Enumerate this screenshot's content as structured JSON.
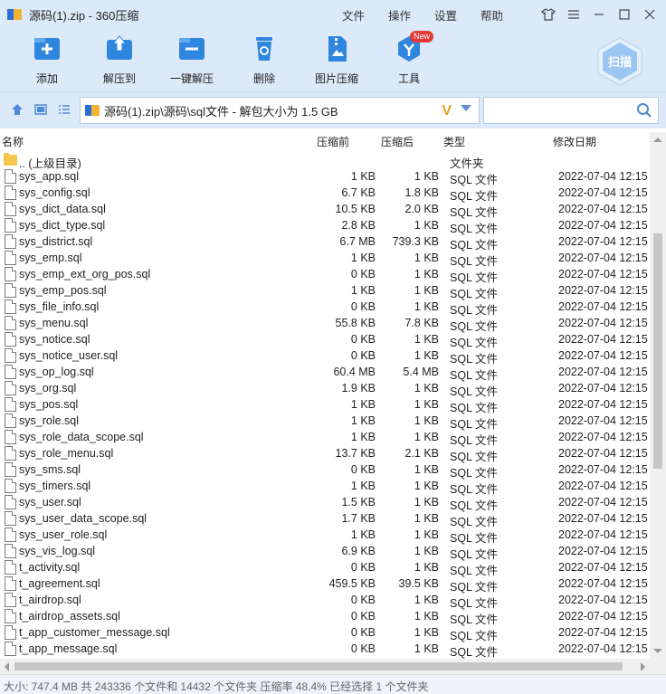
{
  "window": {
    "title": "源码(1).zip - 360压缩",
    "menus": [
      "文件",
      "操作",
      "设置",
      "帮助"
    ]
  },
  "toolbar": {
    "buttons": [
      {
        "label": "添加",
        "icon": "add-icon"
      },
      {
        "label": "解压到",
        "icon": "extract-to-icon"
      },
      {
        "label": "一键解压",
        "icon": "one-click-extract-icon"
      },
      {
        "label": "删除",
        "icon": "delete-icon"
      },
      {
        "label": "图片压缩",
        "icon": "image-compress-icon"
      },
      {
        "label": "工具",
        "icon": "tools-icon",
        "badge": "New"
      }
    ],
    "scan_label": "扫描"
  },
  "address": {
    "path": "源码(1).zip\\源码\\sql文件 - 解包大小为 1.5 GB",
    "search_placeholder": ""
  },
  "columns": {
    "name": "名称",
    "compressed_before": "压缩前",
    "compressed_after": "压缩后",
    "type": "类型",
    "modified": "修改日期"
  },
  "parent_row": {
    "name": ".. (上级目录)",
    "type": "文件夹"
  },
  "files": [
    {
      "name": "sys_app.sql",
      "before": "1 KB",
      "after": "1 KB",
      "type": "SQL 文件",
      "date": "2022-07-04 12:15"
    },
    {
      "name": "sys_config.sql",
      "before": "6.7 KB",
      "after": "1.8 KB",
      "type": "SQL 文件",
      "date": "2022-07-04 12:15"
    },
    {
      "name": "sys_dict_data.sql",
      "before": "10.5 KB",
      "after": "2.0 KB",
      "type": "SQL 文件",
      "date": "2022-07-04 12:15"
    },
    {
      "name": "sys_dict_type.sql",
      "before": "2.8 KB",
      "after": "1 KB",
      "type": "SQL 文件",
      "date": "2022-07-04 12:15"
    },
    {
      "name": "sys_district.sql",
      "before": "6.7 MB",
      "after": "739.3 KB",
      "type": "SQL 文件",
      "date": "2022-07-04 12:15"
    },
    {
      "name": "sys_emp.sql",
      "before": "1 KB",
      "after": "1 KB",
      "type": "SQL 文件",
      "date": "2022-07-04 12:15"
    },
    {
      "name": "sys_emp_ext_org_pos.sql",
      "before": "0 KB",
      "after": "1 KB",
      "type": "SQL 文件",
      "date": "2022-07-04 12:15"
    },
    {
      "name": "sys_emp_pos.sql",
      "before": "1 KB",
      "after": "1 KB",
      "type": "SQL 文件",
      "date": "2022-07-04 12:15"
    },
    {
      "name": "sys_file_info.sql",
      "before": "0 KB",
      "after": "1 KB",
      "type": "SQL 文件",
      "date": "2022-07-04 12:15"
    },
    {
      "name": "sys_menu.sql",
      "before": "55.8 KB",
      "after": "7.8 KB",
      "type": "SQL 文件",
      "date": "2022-07-04 12:15"
    },
    {
      "name": "sys_notice.sql",
      "before": "0 KB",
      "after": "1 KB",
      "type": "SQL 文件",
      "date": "2022-07-04 12:15"
    },
    {
      "name": "sys_notice_user.sql",
      "before": "0 KB",
      "after": "1 KB",
      "type": "SQL 文件",
      "date": "2022-07-04 12:15"
    },
    {
      "name": "sys_op_log.sql",
      "before": "60.4 MB",
      "after": "5.4 MB",
      "type": "SQL 文件",
      "date": "2022-07-04 12:15"
    },
    {
      "name": "sys_org.sql",
      "before": "1.9 KB",
      "after": "1 KB",
      "type": "SQL 文件",
      "date": "2022-07-04 12:15"
    },
    {
      "name": "sys_pos.sql",
      "before": "1 KB",
      "after": "1 KB",
      "type": "SQL 文件",
      "date": "2022-07-04 12:15"
    },
    {
      "name": "sys_role.sql",
      "before": "1 KB",
      "after": "1 KB",
      "type": "SQL 文件",
      "date": "2022-07-04 12:15"
    },
    {
      "name": "sys_role_data_scope.sql",
      "before": "1 KB",
      "after": "1 KB",
      "type": "SQL 文件",
      "date": "2022-07-04 12:15"
    },
    {
      "name": "sys_role_menu.sql",
      "before": "13.7 KB",
      "after": "2.1 KB",
      "type": "SQL 文件",
      "date": "2022-07-04 12:15"
    },
    {
      "name": "sys_sms.sql",
      "before": "0 KB",
      "after": "1 KB",
      "type": "SQL 文件",
      "date": "2022-07-04 12:15"
    },
    {
      "name": "sys_timers.sql",
      "before": "1 KB",
      "after": "1 KB",
      "type": "SQL 文件",
      "date": "2022-07-04 12:15"
    },
    {
      "name": "sys_user.sql",
      "before": "1.5 KB",
      "after": "1 KB",
      "type": "SQL 文件",
      "date": "2022-07-04 12:15"
    },
    {
      "name": "sys_user_data_scope.sql",
      "before": "1.7 KB",
      "after": "1 KB",
      "type": "SQL 文件",
      "date": "2022-07-04 12:15"
    },
    {
      "name": "sys_user_role.sql",
      "before": "1 KB",
      "after": "1 KB",
      "type": "SQL 文件",
      "date": "2022-07-04 12:15"
    },
    {
      "name": "sys_vis_log.sql",
      "before": "6.9 KB",
      "after": "1 KB",
      "type": "SQL 文件",
      "date": "2022-07-04 12:15"
    },
    {
      "name": "t_activity.sql",
      "before": "0 KB",
      "after": "1 KB",
      "type": "SQL 文件",
      "date": "2022-07-04 12:15"
    },
    {
      "name": "t_agreement.sql",
      "before": "459.5 KB",
      "after": "39.5 KB",
      "type": "SQL 文件",
      "date": "2022-07-04 12:15"
    },
    {
      "name": "t_airdrop.sql",
      "before": "0 KB",
      "after": "1 KB",
      "type": "SQL 文件",
      "date": "2022-07-04 12:15"
    },
    {
      "name": "t_airdrop_assets.sql",
      "before": "0 KB",
      "after": "1 KB",
      "type": "SQL 文件",
      "date": "2022-07-04 12:15"
    },
    {
      "name": "t_app_customer_message.sql",
      "before": "0 KB",
      "after": "1 KB",
      "type": "SQL 文件",
      "date": "2022-07-04 12:15"
    },
    {
      "name": "t_app_message.sql",
      "before": "0 KB",
      "after": "1 KB",
      "type": "SQL 文件",
      "date": "2022-07-04 12:15"
    }
  ],
  "status": "大小: 747.4 MB 共 243336 个文件和 14432 个文件夹 压缩率 48.4% 已经选择 1 个文件夹"
}
